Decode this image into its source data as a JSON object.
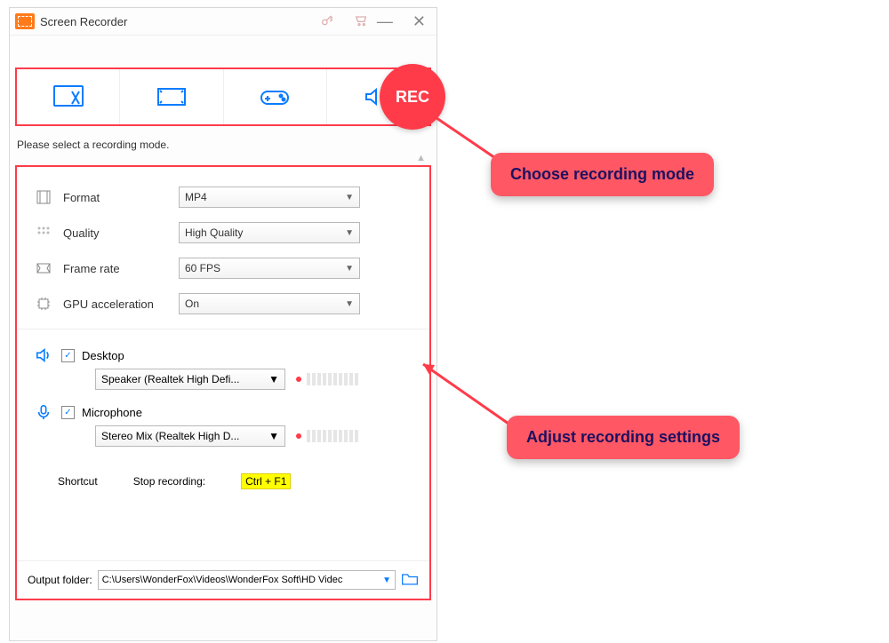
{
  "title": "Screen Recorder",
  "rec_label": "REC",
  "hint": "Please select a recording mode.",
  "settings": {
    "format_label": "Format",
    "format_value": "MP4",
    "quality_label": "Quality",
    "quality_value": "High Quality",
    "framerate_label": "Frame rate",
    "framerate_value": "60 FPS",
    "gpu_label": "GPU acceleration",
    "gpu_value": "On"
  },
  "audio": {
    "desktop_label": "Desktop",
    "desktop_device": "Speaker (Realtek High Defi...",
    "mic_label": "Microphone",
    "mic_device": "Stereo Mix (Realtek High D..."
  },
  "shortcut": {
    "label": "Shortcut",
    "stop_label": "Stop recording:",
    "stop_key": "Ctrl + F1"
  },
  "output": {
    "label": "Output folder:",
    "path": "C:\\Users\\WonderFox\\Videos\\WonderFox Soft\\HD Videc"
  },
  "callouts": {
    "mode": "Choose recording mode",
    "settings": "Adjust recording settings"
  }
}
